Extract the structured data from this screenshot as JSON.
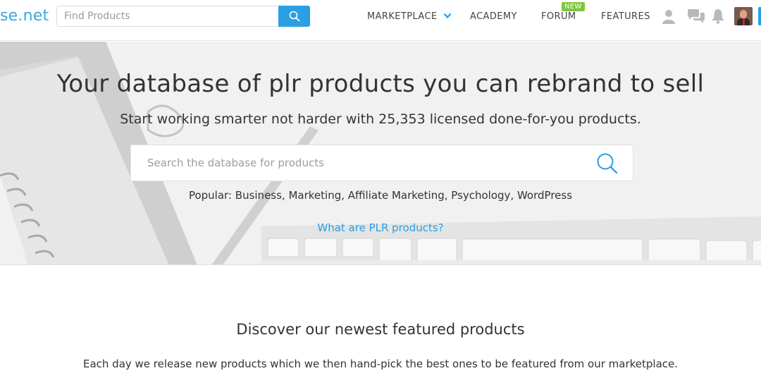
{
  "header": {
    "logo_text": "se.net",
    "search_placeholder": "Find Products",
    "nav": {
      "marketplace": "MARKETPLACE",
      "academy": "ACADEMY",
      "forum": "FORUM",
      "forum_badge": "NEW",
      "features": "FEATURES"
    },
    "icons": [
      "user-icon",
      "chat-icon",
      "bell-icon"
    ],
    "accent_color": "#2a9fe3",
    "badge_color": "#7dc63b"
  },
  "hero": {
    "title": "Your database of plr products you can rebrand to sell",
    "subtitle": "Start working smarter not harder with 25,353 licensed done-for-you products.",
    "search_placeholder": "Search the database for products",
    "popular_label": "Popular:",
    "popular_items": [
      "Business",
      "Marketing",
      "Affiliate Marketing",
      "Psychology",
      "WordPress"
    ],
    "plr_link": "What are PLR products?"
  },
  "featured": {
    "title": "Discover our newest featured products",
    "description": "Each day we release new products which we then hand-pick the best ones to be featured from our marketplace."
  }
}
